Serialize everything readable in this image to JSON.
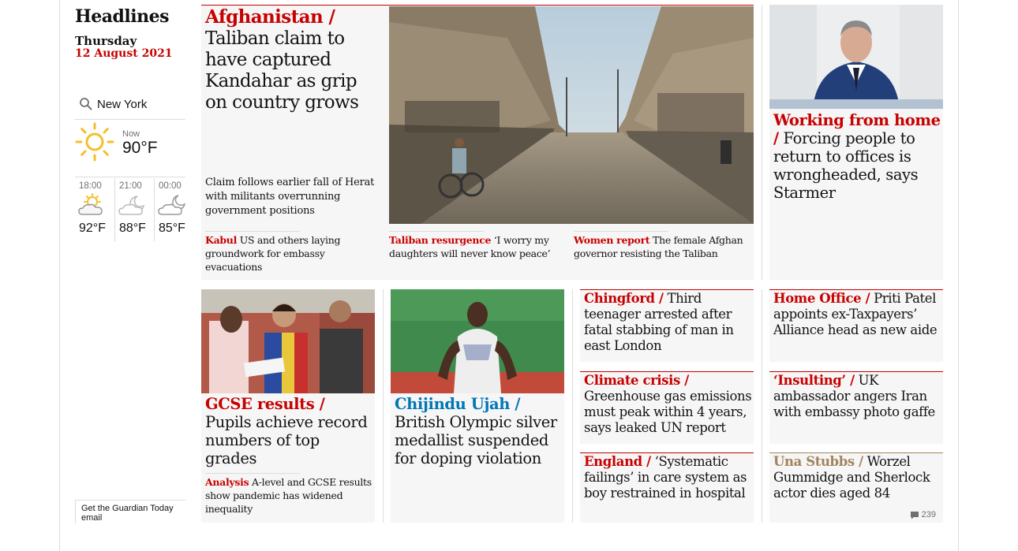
{
  "headlines_title": "Headlines",
  "date": {
    "day": "Thursday",
    "full": "12 August 2021"
  },
  "weather": {
    "location": "New York",
    "now_label": "Now",
    "now_temp": "90°F",
    "forecast": [
      {
        "time": "18:00",
        "temp": "92°F",
        "icon": "partly-cloudy-sun-icon"
      },
      {
        "time": "21:00",
        "temp": "88°F",
        "icon": "cloudy-moon-icon"
      },
      {
        "time": "00:00",
        "temp": "85°F",
        "icon": "partly-cloudy-moon-icon"
      }
    ]
  },
  "email_signup": "Get the Guardian Today email",
  "main_story": {
    "kicker": "Afghanistan /",
    "headline": "Taliban claim to have captured Kandahar as grip on country grows",
    "standfirst": "Claim follows earlier fall of Herat with militants overrunning government positions",
    "sublinks": [
      {
        "kicker": "Kabul",
        "text": "US and others laying groundwork for embassy evacuations"
      },
      {
        "kicker": "Taliban resurgence",
        "text": "‘I worry my daughters will never know peace’"
      },
      {
        "kicker": "Women report",
        "text": "The female Afghan governor resisting the Taliban"
      }
    ]
  },
  "wfh_story": {
    "kicker": "Working from home /",
    "headline": "Forcing people to return to offices is wrongheaded, says Starmer"
  },
  "gcse_story": {
    "kicker": "GCSE results /",
    "headline": "Pupils achieve record numbers of top grades",
    "sublink": {
      "kicker": "Analysis",
      "text": "A-level and GCSE results show pandemic has widened inequality"
    }
  },
  "olympic_story": {
    "kicker": "Chijindu Ujah /",
    "headline": "British Olympic silver medallist suspended for doping violation"
  },
  "small_stories": [
    {
      "kicker": "Chingford /",
      "headline": "Third teenager arrested after fatal stabbing of man in east London"
    },
    {
      "kicker": "Climate crisis /",
      "headline": "Greenhouse gas emissions must peak within 4 years, says leaked UN report"
    },
    {
      "kicker": "England /",
      "headline": "‘Systematic failings’ in care system as boy restrained in hospital"
    },
    {
      "kicker": "Home Office /",
      "headline": "Priti Patel appoints ex-Taxpayers’ Alliance head as new aide"
    },
    {
      "kicker": "‘Insulting’ /",
      "headline": "UK ambassador angers Iran with embassy photo gaffe"
    },
    {
      "kicker": "Una Stubbs /",
      "headline": "Worzel Gummidge and Sherlock actor dies aged 84",
      "comments": "239"
    }
  ],
  "colors": {
    "news_red": "#c70000",
    "sport_blue": "#0077b6",
    "obituary_tan": "#a1845c",
    "card_bg": "#f6f6f6"
  }
}
